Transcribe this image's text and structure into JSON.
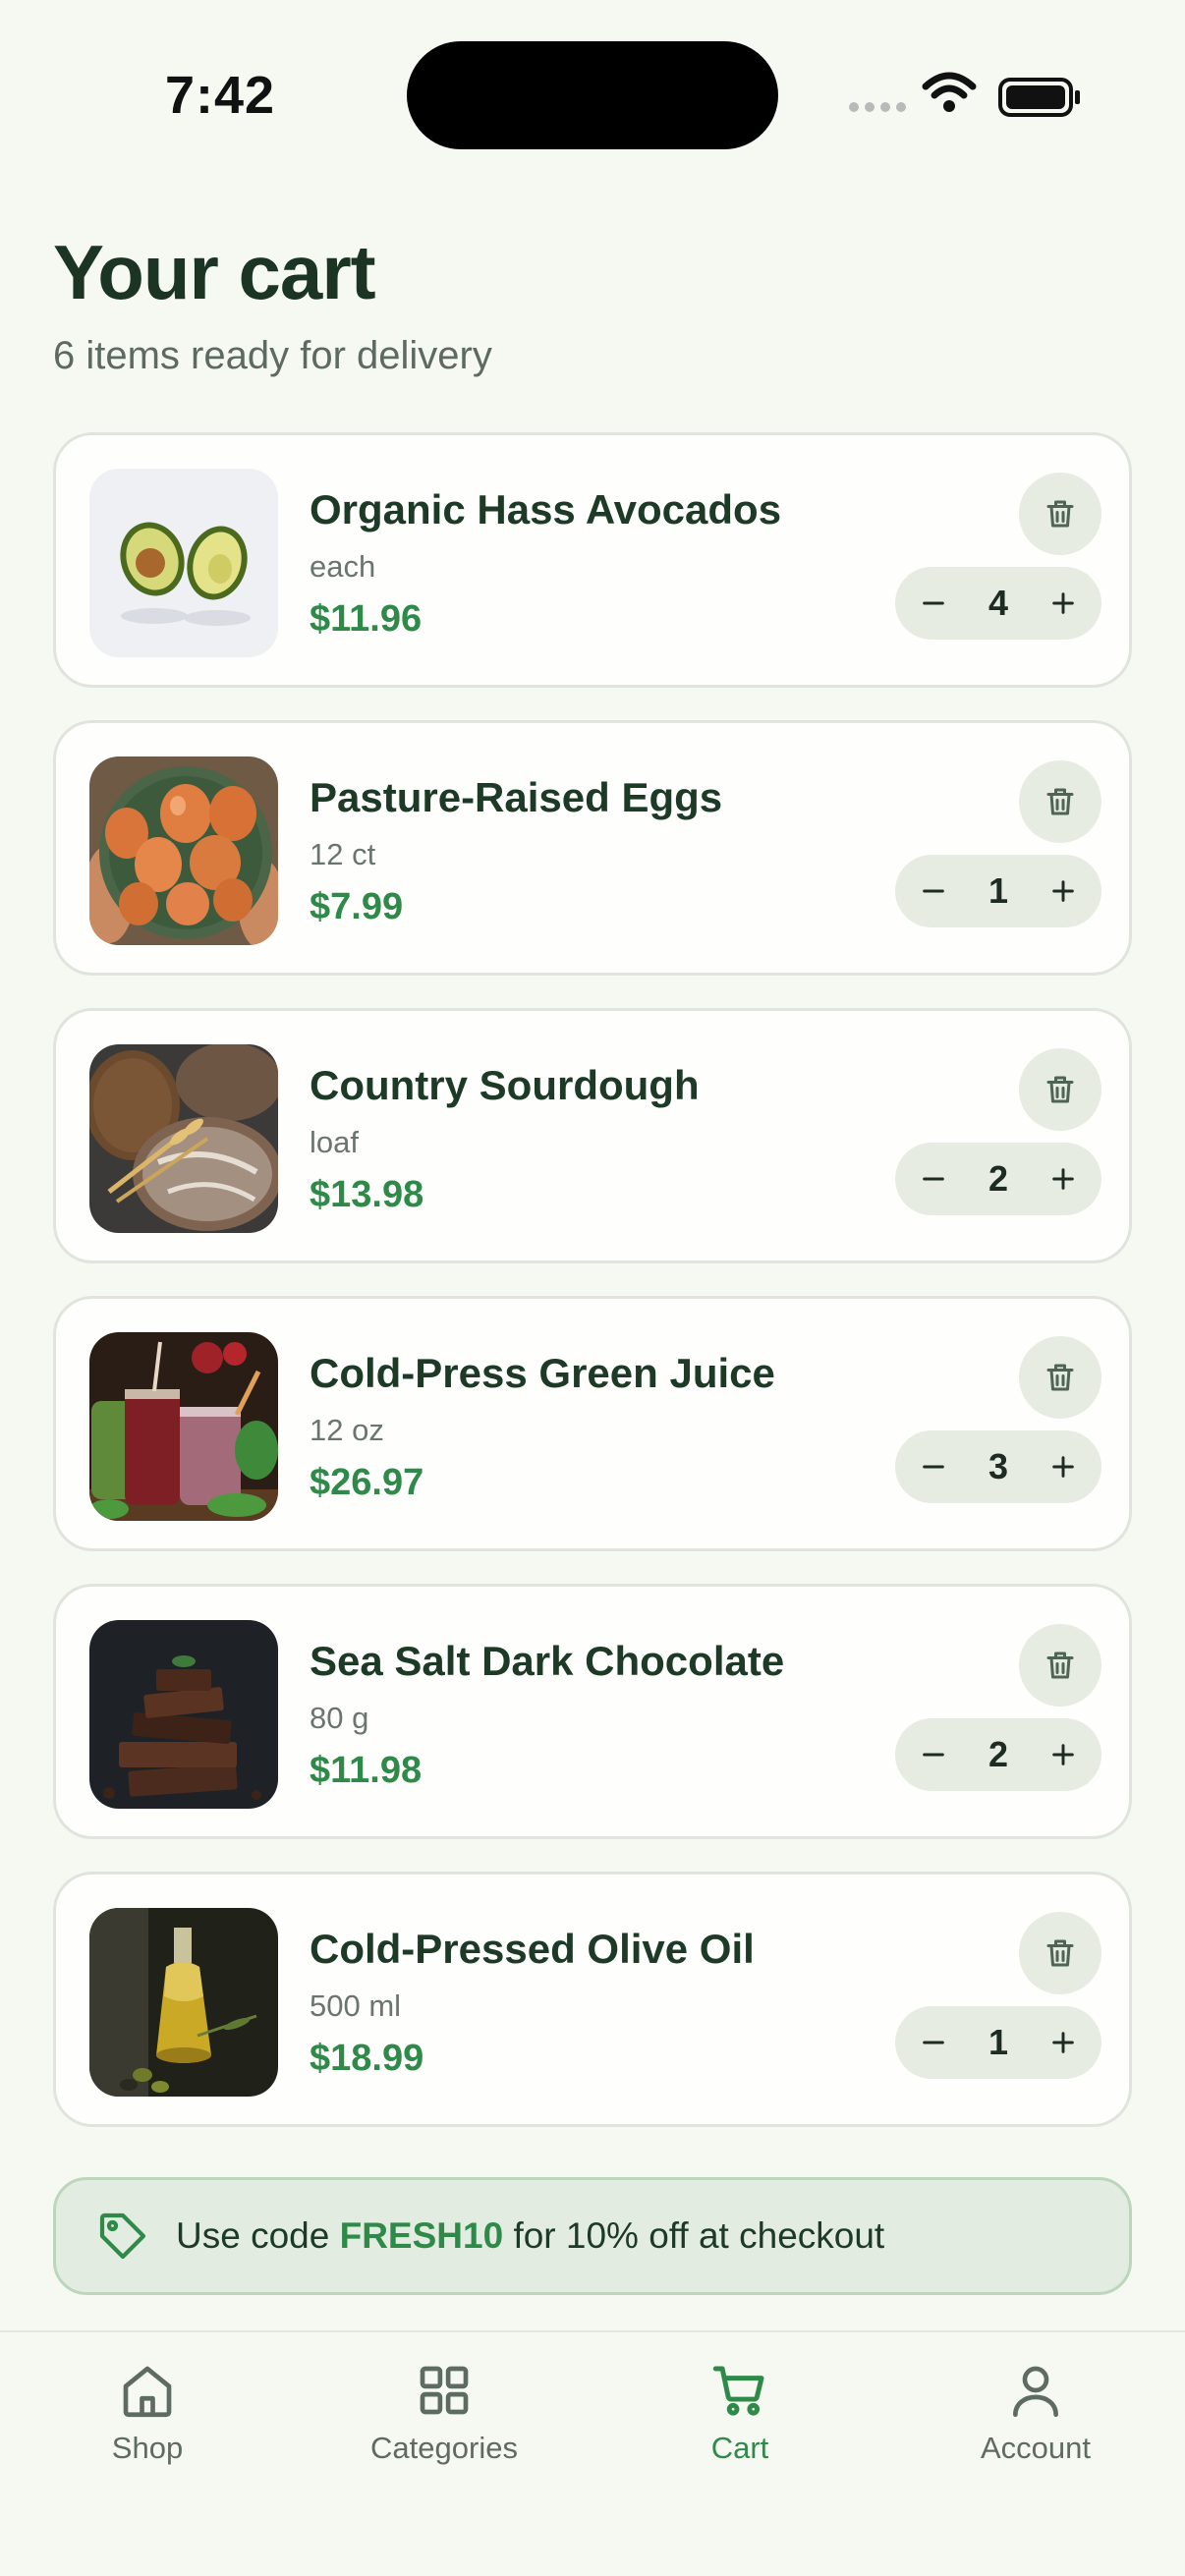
{
  "status_bar": {
    "time": "7:42"
  },
  "header": {
    "title": "Your cart",
    "subtitle": "6 items ready for delivery"
  },
  "cart": {
    "items": [
      {
        "name": "Organic Hass Avocados",
        "unit": "each",
        "price": "$11.96",
        "quantity": "4",
        "image": "avocado-photo"
      },
      {
        "name": "Pasture-Raised Eggs",
        "unit": "12 ct",
        "price": "$7.99",
        "quantity": "1",
        "image": "eggs-photo"
      },
      {
        "name": "Country Sourdough",
        "unit": "loaf",
        "price": "$13.98",
        "quantity": "2",
        "image": "bread-photo"
      },
      {
        "name": "Cold-Press Green Juice",
        "unit": "12 oz",
        "price": "$26.97",
        "quantity": "3",
        "image": "juice-photo"
      },
      {
        "name": "Sea Salt Dark Chocolate",
        "unit": "80 g",
        "price": "$11.98",
        "quantity": "2",
        "image": "chocolate-photo"
      },
      {
        "name": "Cold-Pressed Olive Oil",
        "unit": "500 ml",
        "price": "$18.99",
        "quantity": "1",
        "image": "olive-oil-photo"
      }
    ]
  },
  "promo": {
    "prefix": "Use code",
    "code": "FRESH10",
    "suffix": "for 10% off at checkout",
    "icon": "tag-icon"
  },
  "nav": {
    "items": [
      {
        "label": "Shop",
        "icon": "home-icon",
        "active": false
      },
      {
        "label": "Categories",
        "icon": "grid-icon",
        "active": false
      },
      {
        "label": "Cart",
        "icon": "cart-icon",
        "active": true
      },
      {
        "label": "Account",
        "icon": "user-icon",
        "active": false
      }
    ]
  },
  "colors": {
    "accent": "#2f8a4a",
    "text": "#1d3a26",
    "background": "#f6f9f2",
    "chip": "#e6ece2"
  }
}
